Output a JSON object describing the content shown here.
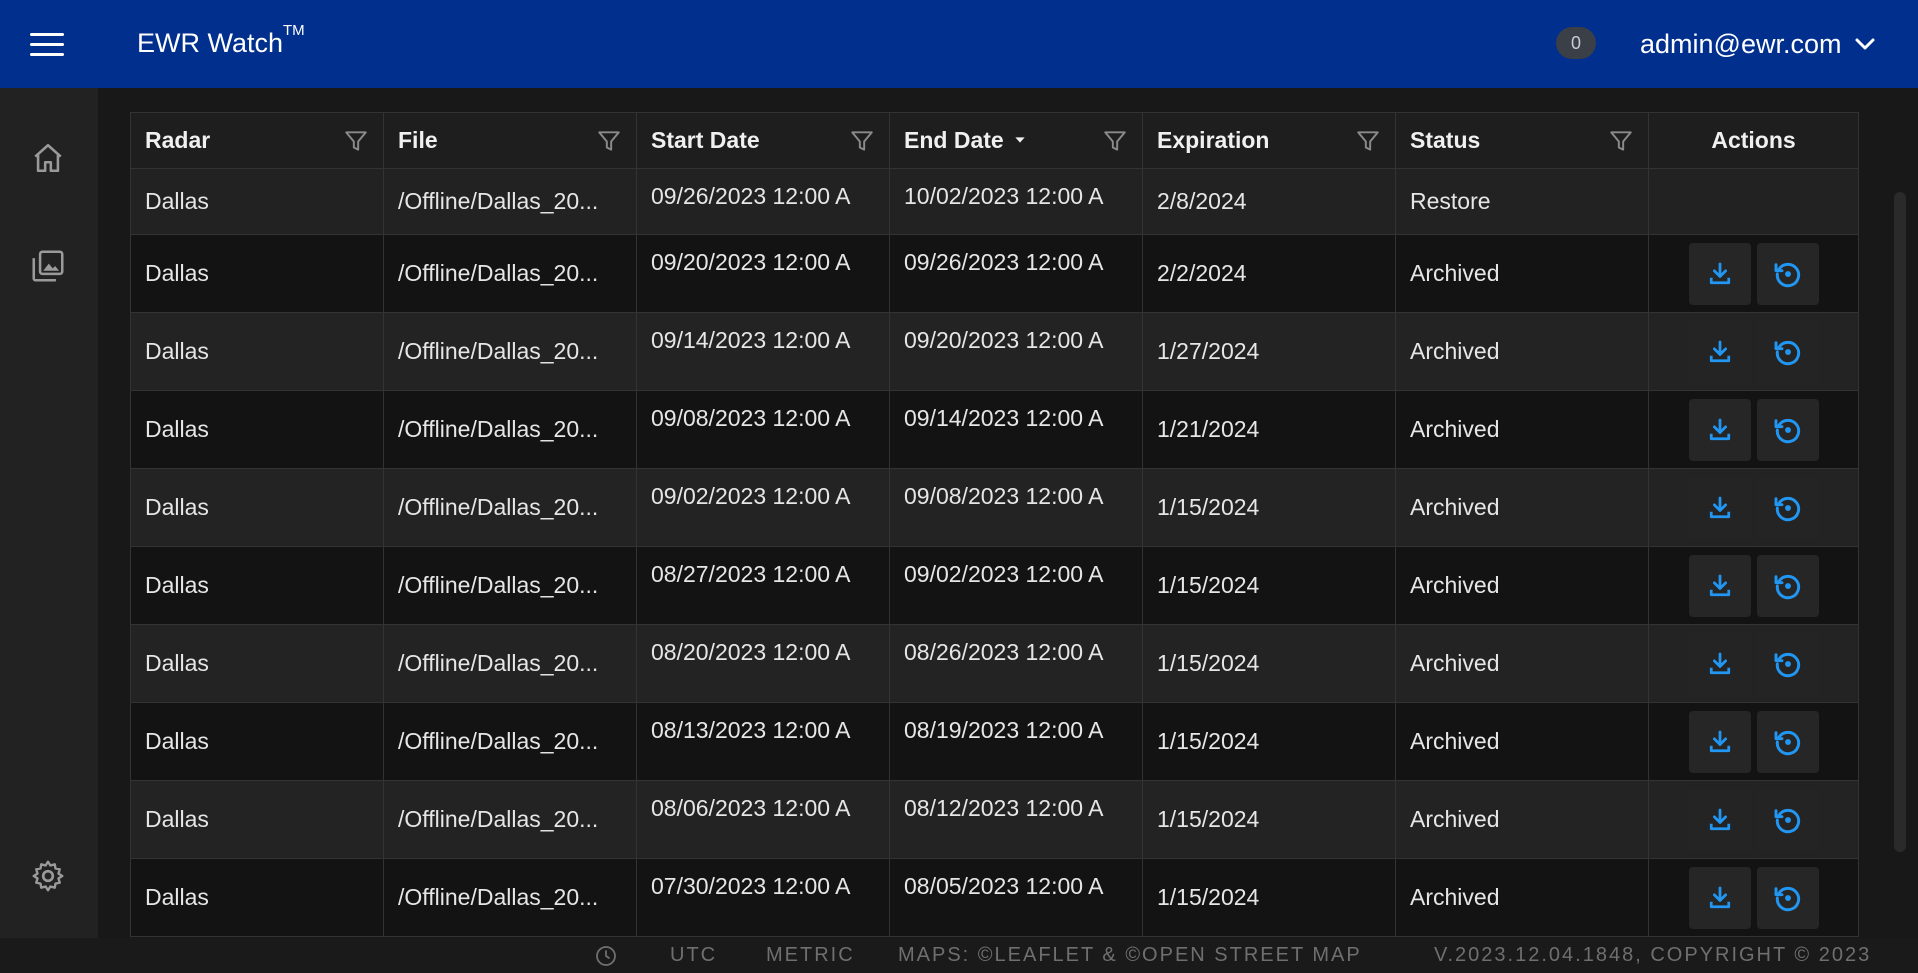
{
  "header": {
    "title": "EWR Watch",
    "title_tm": "TM",
    "notification_count": "0",
    "user_email": "admin@ewr.com"
  },
  "sidebar": {
    "items": [
      {
        "icon": "home-icon"
      },
      {
        "icon": "gallery-icon"
      },
      {
        "icon": "gear-icon"
      }
    ]
  },
  "table": {
    "columns": [
      {
        "label": "Radar",
        "filter": true
      },
      {
        "label": "File",
        "filter": true
      },
      {
        "label": "Start Date",
        "filter": true
      },
      {
        "label": "End Date",
        "filter": true,
        "sorted": "desc"
      },
      {
        "label": "Expiration",
        "filter": true
      },
      {
        "label": "Status",
        "filter": true
      },
      {
        "label": "Actions",
        "filter": false
      }
    ],
    "rows": [
      {
        "radar": "Dallas",
        "file": "/Offline/Dallas_20...",
        "start": "09/26/2023 12:00 A",
        "end": "10/02/2023 12:00 A",
        "expiration": "2/8/2024",
        "status": "Restore"
      },
      {
        "radar": "Dallas",
        "file": "/Offline/Dallas_20...",
        "start": "09/20/2023 12:00 A",
        "end": "09/26/2023 12:00 A",
        "expiration": "2/2/2024",
        "status": "Archived"
      },
      {
        "radar": "Dallas",
        "file": "/Offline/Dallas_20...",
        "start": "09/14/2023 12:00 A",
        "end": "09/20/2023 12:00 A",
        "expiration": "1/27/2024",
        "status": "Archived"
      },
      {
        "radar": "Dallas",
        "file": "/Offline/Dallas_20...",
        "start": "09/08/2023 12:00 A",
        "end": "09/14/2023 12:00 A",
        "expiration": "1/21/2024",
        "status": "Archived"
      },
      {
        "radar": "Dallas",
        "file": "/Offline/Dallas_20...",
        "start": "09/02/2023 12:00 A",
        "end": "09/08/2023 12:00 A",
        "expiration": "1/15/2024",
        "status": "Archived"
      },
      {
        "radar": "Dallas",
        "file": "/Offline/Dallas_20...",
        "start": "08/27/2023 12:00 A",
        "end": "09/02/2023 12:00 A",
        "expiration": "1/15/2024",
        "status": "Archived"
      },
      {
        "radar": "Dallas",
        "file": "/Offline/Dallas_20...",
        "start": "08/20/2023 12:00 A",
        "end": "08/26/2023 12:00 A",
        "expiration": "1/15/2024",
        "status": "Archived"
      },
      {
        "radar": "Dallas",
        "file": "/Offline/Dallas_20...",
        "start": "08/13/2023 12:00 A",
        "end": "08/19/2023 12:00 A",
        "expiration": "1/15/2024",
        "status": "Archived"
      },
      {
        "radar": "Dallas",
        "file": "/Offline/Dallas_20...",
        "start": "08/06/2023 12:00 A",
        "end": "08/12/2023 12:00 A",
        "expiration": "1/15/2024",
        "status": "Archived"
      },
      {
        "radar": "Dallas",
        "file": "/Offline/Dallas_20...",
        "start": "07/30/2023 12:00 A",
        "end": "08/05/2023 12:00 A",
        "expiration": "1/15/2024",
        "status": "Archived"
      }
    ]
  },
  "footer": {
    "timezone": "UTC",
    "units": "METRIC",
    "maps_credit": "MAPS: ©LEAFLET & ©OPEN STREET MAP",
    "version": "V.2023.12.04.1848, COPYRIGHT © 2023"
  },
  "colors": {
    "header_bg": "#002f8e",
    "accent": "#2196f3",
    "surface": "#181818"
  }
}
